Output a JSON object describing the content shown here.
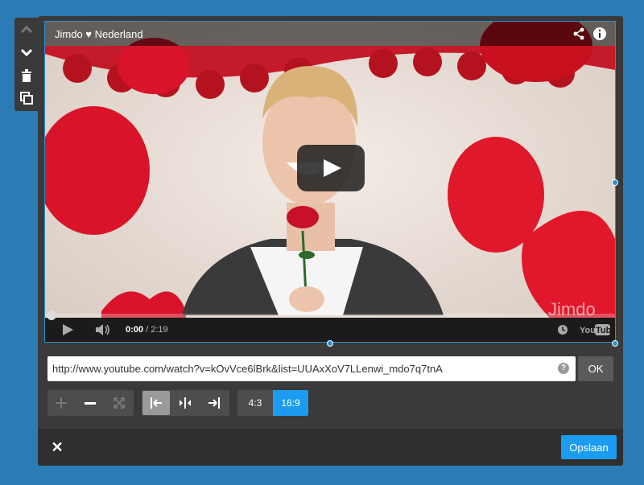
{
  "video": {
    "channel_title": "Jimdo ♥ Nederland",
    "current_time": "0:00",
    "duration": "/ 2:19",
    "progress": 0,
    "logo": "You Tube"
  },
  "url_field": {
    "value": "http://www.youtube.com/watch?v=kOvVce6lBrk&list=UUAxXoV7LLenwi_mdo7q7tnA",
    "help": "?",
    "ok_label": "OK"
  },
  "aspect": {
    "ratio_4_3": "4:3",
    "ratio_16_9": "16:9",
    "selected": "16:9"
  },
  "footer": {
    "close": "✕",
    "save_label": "Opslaan"
  },
  "colors": {
    "accent": "#1c9cf0",
    "background": "#2b7bb5",
    "panel": "#3a3a3a"
  },
  "icons": {
    "move_up": "chevron-up-icon",
    "move_down": "chevron-down-icon",
    "delete": "trash-icon",
    "duplicate": "copy-icon",
    "share": "share-icon",
    "info": "info-icon",
    "play": "play-icon",
    "volume": "volume-icon",
    "watch_later": "clock-icon"
  }
}
